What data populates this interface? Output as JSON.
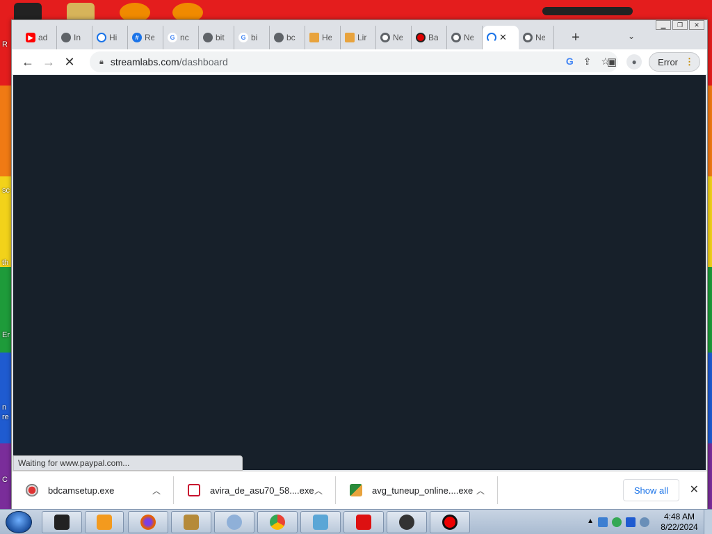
{
  "desktop": {
    "side_texts": [
      "R",
      "sc",
      "th",
      "Er",
      "n",
      "re",
      "C"
    ]
  },
  "window": {
    "controls": [
      "minimize",
      "restore",
      "close"
    ]
  },
  "tabs": [
    {
      "title": "ad",
      "icon": "youtube-icon",
      "color": "#ff0000"
    },
    {
      "title": "In",
      "icon": "globe-icon",
      "color": "#5f6368"
    },
    {
      "title": "Hi",
      "icon": "history-icon",
      "color": "#1a73e8"
    },
    {
      "title": "Re",
      "icon": "hash-icon",
      "color": "#1a73e8"
    },
    {
      "title": "nc",
      "icon": "google-icon",
      "color": "#4285f4"
    },
    {
      "title": "bit",
      "icon": "globe-icon",
      "color": "#5f6368"
    },
    {
      "title": "bi",
      "icon": "google-icon",
      "color": "#4285f4"
    },
    {
      "title": "bc",
      "icon": "globe-icon",
      "color": "#5f6368"
    },
    {
      "title": "He",
      "icon": "folder-icon",
      "color": "#e8a33d"
    },
    {
      "title": "Lir",
      "icon": "folder-icon",
      "color": "#e8a33d"
    },
    {
      "title": "Ne",
      "icon": "chrome-icon",
      "color": "#5f6368"
    },
    {
      "title": "Ba",
      "icon": "record-icon",
      "color": "#e00000"
    },
    {
      "title": "Ne",
      "icon": "chrome-icon",
      "color": "#5f6368"
    },
    {
      "title": "",
      "icon": "loading-spinner-icon",
      "color": "#1a73e8",
      "active": true
    },
    {
      "title": "Ne",
      "icon": "chrome-icon",
      "color": "#5f6368"
    }
  ],
  "toolbar": {
    "url_host": "streamlabs.com",
    "url_path": "/dashboard",
    "error_label": "Error"
  },
  "status": {
    "text": "Waiting for www.paypal.com..."
  },
  "downloads": [
    {
      "name": "bdcamsetup.exe",
      "icon_color": "#d33"
    },
    {
      "name": "avira_de_asu70_58....exe",
      "icon_color": "#c8102e"
    },
    {
      "name": "avg_tuneup_online....exe",
      "icon_color": "#2a8a3a"
    }
  ],
  "download_shelf": {
    "show_all_label": "Show all"
  },
  "taskbar": {
    "apps": [
      {
        "name": "black-app",
        "color": "#222"
      },
      {
        "name": "media-player",
        "color": "#f39a1e"
      },
      {
        "name": "firefox",
        "color": "#e66000"
      },
      {
        "name": "box-app",
        "color": "#b58a3a"
      },
      {
        "name": "disc-app",
        "color": "#8fb0d8"
      },
      {
        "name": "chrome",
        "color": "#34a853"
      },
      {
        "name": "blue-app",
        "color": "#5aa6d6"
      },
      {
        "name": "avira",
        "color": "#d11"
      },
      {
        "name": "obs",
        "color": "#333"
      },
      {
        "name": "recorder",
        "color": "#e00"
      }
    ],
    "time": "4:48 AM",
    "date": "8/22/2024"
  }
}
